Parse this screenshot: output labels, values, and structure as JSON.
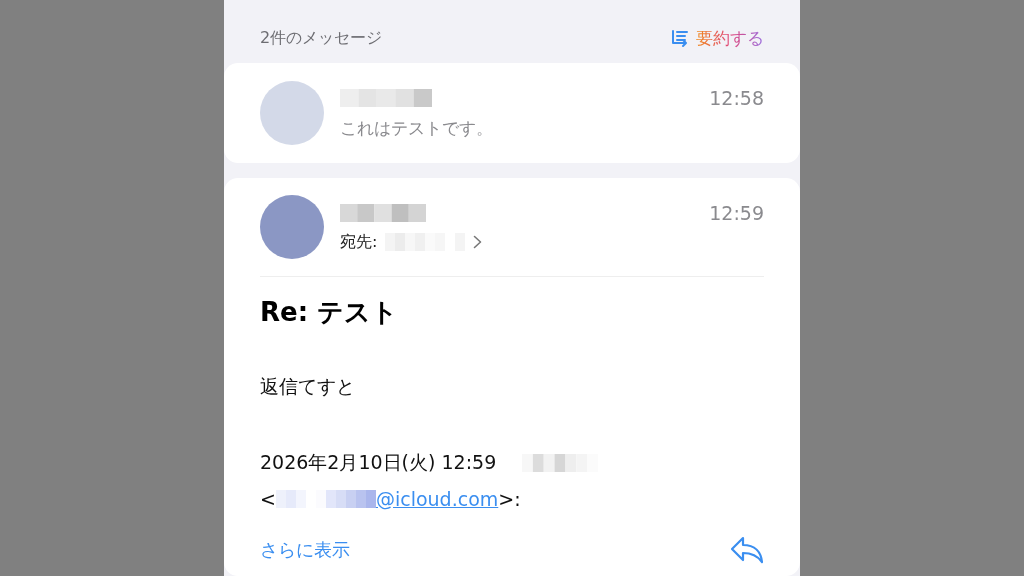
{
  "header": {
    "count": "2件のメッセージ",
    "summarize": "要約する"
  },
  "messages": [
    {
      "kind": "collapsed",
      "color": "#d3d9e8",
      "time": "12:58",
      "preview": "これはテストです。"
    },
    {
      "kind": "expanded",
      "color": "#8b97c4",
      "time": "12:59",
      "to_label": "宛先:",
      "subject": "Re: テスト",
      "body": "返信てすと",
      "quote_date": "2026年2月10日(火) 12:59",
      "email_prefix": "<",
      "email_link": "@icloud.com",
      "email_suffix": ">:",
      "more": "さらに表示"
    }
  ]
}
